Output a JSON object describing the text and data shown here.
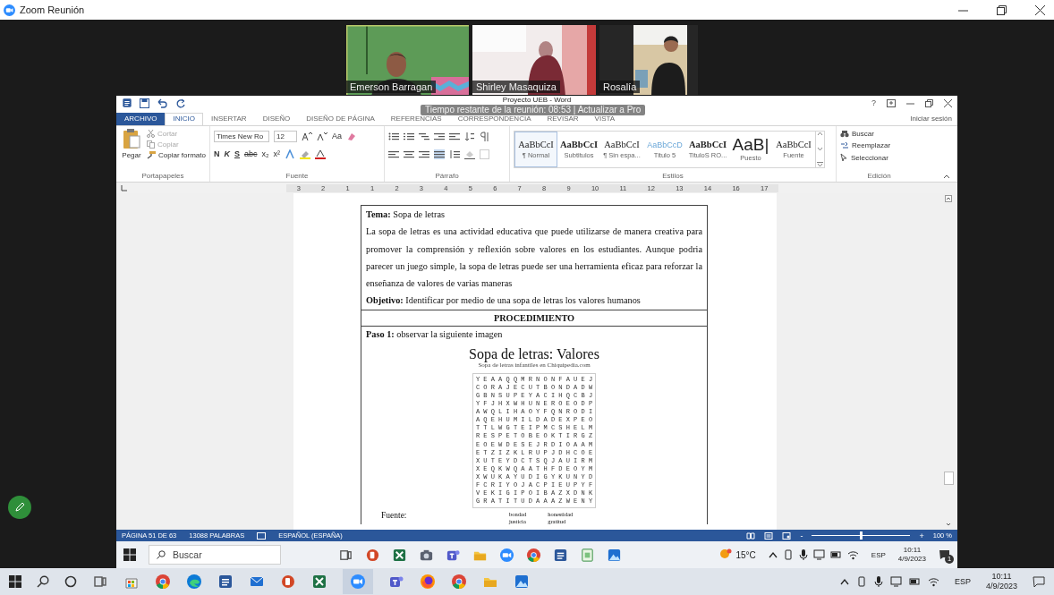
{
  "window": {
    "title": "Zoom Reunión"
  },
  "participants": [
    {
      "name": "Emerson Barragan",
      "speaking": true
    },
    {
      "name": "Shirley Masaquiza",
      "speaking": false
    },
    {
      "name": "Rosalía",
      "speaking": false
    }
  ],
  "meeting_banner": "Tiempo restante de la reunión: 08:53 | Actualizar a Pro",
  "word": {
    "title": "Proyecto UEB - Word",
    "help": "?",
    "sign_in": "Iniciar sesión",
    "tabs": [
      {
        "label": "ARCHIVO",
        "kind": "file",
        "selected": false
      },
      {
        "label": "INICIO",
        "kind": "tab",
        "selected": true
      },
      {
        "label": "INSERTAR",
        "kind": "tab",
        "selected": false
      },
      {
        "label": "DISEÑO",
        "kind": "tab",
        "selected": false
      },
      {
        "label": "DISEÑO DE PÁGINA",
        "kind": "tab",
        "selected": false
      },
      {
        "label": "REFERENCIAS",
        "kind": "tab",
        "selected": false
      },
      {
        "label": "CORRESPONDENCIA",
        "kind": "tab",
        "selected": false
      },
      {
        "label": "REVISAR",
        "kind": "tab",
        "selected": false
      },
      {
        "label": "VISTA",
        "kind": "tab",
        "selected": false
      }
    ],
    "clipboard": {
      "paste": "Pegar",
      "cut": {
        "label": "Cortar",
        "disabled": true
      },
      "copy": {
        "label": "Copiar",
        "disabled": true
      },
      "format_painter": {
        "label": "Copiar formato",
        "disabled": false
      },
      "group": "Portapapeles"
    },
    "font": {
      "name": "Times New Ro",
      "size": "12",
      "case": "Aa",
      "format_buttons": [
        "N",
        "K",
        "S",
        "abc",
        "x₂",
        "x²"
      ],
      "group": "Fuente"
    },
    "paragraph": {
      "group": "Párrafo"
    },
    "styles": {
      "group": "Estilos",
      "items": [
        {
          "sample": "AaBbCcI",
          "label": "¶ Normal",
          "kind": "serif",
          "selected": true
        },
        {
          "sample": "AaBbCcI",
          "label": "Subtitulos",
          "kind": "bold",
          "selected": false
        },
        {
          "sample": "AaBbCcI",
          "label": "¶ Sin espa...",
          "kind": "serif",
          "selected": false
        },
        {
          "sample": "AaBbCcD",
          "label": "Titulo 5",
          "kind": "light",
          "selected": false
        },
        {
          "sample": "AaBbCcI",
          "label": "TituloS RO...",
          "kind": "bold",
          "selected": false
        },
        {
          "sample": "AaB|",
          "label": "Puesto",
          "kind": "large",
          "selected": false
        },
        {
          "sample": "AaBbCcI",
          "label": "Fuente",
          "kind": "serif",
          "selected": false
        }
      ]
    },
    "editing": {
      "find": "Buscar",
      "replace": "Reemplazar",
      "select": "Seleccionar",
      "group": "Edición"
    },
    "ruler": [
      "3",
      "2",
      "1",
      "1",
      "2",
      "3",
      "4",
      "5",
      "6",
      "7",
      "8",
      "9",
      "10",
      "11",
      "12",
      "13",
      "14",
      "16",
      "17"
    ],
    "document": {
      "topic": "**Tema:** Sopa de letras",
      "intro": "La sopa de letras es una actividad educativa que puede utilizarse de manera creativa para promover la comprensión y reflexión sobre valores en los estudiantes. Aunque podria parecer un juego simple, la sopa de letras puede ser una herramienta eficaz para reforzar la enseñanza de valores de varias maneras",
      "objective": "**Objetivo:** Identificar por medio de una sopa de letras los valores humanos",
      "section": "PROCEDIMIENTO",
      "step": "**Paso 1:** observar la siguiente imagen",
      "puzzle": {
        "title": "Sopa de letras: Valores",
        "subtitle": "Sopa de letras infantiles en Chiquipedia.com",
        "rows": [
          "Y E A A Q Q M R N O N F A U E J",
          "C O R A J E C U T B O N D A D W",
          "G B N S U P E Y A C I H Q C B J",
          "Y F J H X W H U N E R O E O D P",
          "A W Q L I H A O Y F Q N R O D I",
          "A Q E H U M I L D A D E X P E O",
          "T T L W G T E I P M C S H E L M",
          "R E S P E T O B E O K T I R G Z",
          "E O E W D E S E J R D I O A A M",
          "E T Z I Z K L R U P J D H C O E",
          "X U T E Y D C T S Q J A U I R M",
          "X E Q K W Q A A T H F D E O Y M",
          "X W U K A Y U D I G Y K U N Y D",
          "F C R I Y O J A C P I E U P Y F",
          "V E K I G I P O I B A Z X D N K",
          "G R A T I T U D A A A Z W E N Y"
        ],
        "words": [
          "bondad",
          "justicia",
          "honestidad",
          "gratitud"
        ]
      },
      "source": "Fuente:"
    },
    "status": {
      "page": "PÁGINA 51 DE 63",
      "words": "13088 PALABRAS",
      "language": "ESPAÑOL (ESPAÑA)",
      "zoom": "100 %",
      "zoom_out": "-",
      "zoom_in": "+",
      "zoom_slider": {
        "level": 0.5
      }
    }
  },
  "shared_taskbar": {
    "search": {
      "placeholder": "Buscar"
    },
    "weather": "15°C",
    "language": "ESP",
    "time": "10:11",
    "date": "4/9/2023",
    "notification_count": "1"
  },
  "taskbar": {
    "language": "ESP",
    "time": "10:11",
    "date": "4/9/2023"
  }
}
